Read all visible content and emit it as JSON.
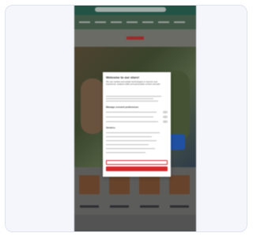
{
  "consent": {
    "title": "Welcome to our store!",
    "intro": "We use cookies and similar technologies to improve your experience, analyse traffic and personalise content and ads.",
    "section_manage": "Manage consent preferences",
    "section_vendors": "Vendors",
    "accept_selected_label": "",
    "accept_all_label": ""
  },
  "colors": {
    "accent": "#d62a2a",
    "card_background": "#f4f6fb",
    "site_header": "#2f6f5c"
  },
  "icons": {
    "brand_logo": "logo-icon"
  }
}
